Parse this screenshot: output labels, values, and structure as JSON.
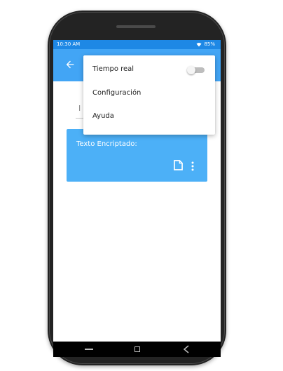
{
  "status_bar": {
    "time": "10:30 AM",
    "battery": "85%",
    "icons": [
      "wifi-icon"
    ]
  },
  "app_bar": {
    "icon": "arrow-back-icon",
    "color": "#42a5f5"
  },
  "input": {
    "placeholder": "I"
  },
  "result_card": {
    "label": "Texto Encriptado:",
    "icons": [
      "copy-icon",
      "more-vert-icon"
    ],
    "color": "#4cb0f7"
  },
  "menu": {
    "items": [
      {
        "label": "Tiempo real",
        "toggle": false
      },
      {
        "label": "Configuración"
      },
      {
        "label": "Ayuda"
      }
    ]
  },
  "nav_bar": {
    "icons": [
      "recent-apps-icon",
      "home-icon",
      "back-icon"
    ]
  },
  "colors": {
    "status_bar": "#1e88e5",
    "accent": "#42a5f5"
  }
}
